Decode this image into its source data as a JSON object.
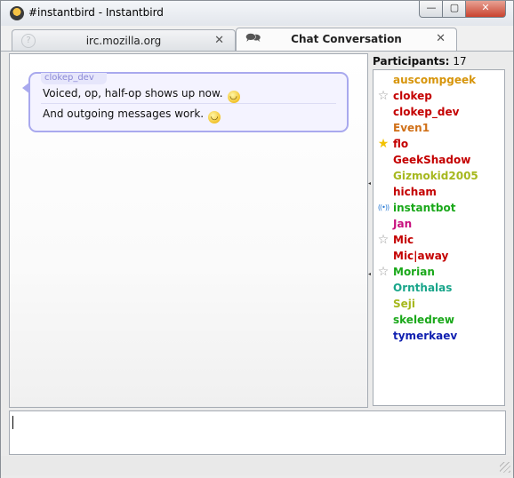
{
  "window": {
    "title": "#instantbird - Instantbird",
    "minimize_label": "—",
    "maximize_label": "▢",
    "close_label": "✕"
  },
  "tabs": [
    {
      "label": "irc.mozilla.org",
      "icon": "help-icon",
      "close_label": "✕"
    },
    {
      "label": "Chat Conversation",
      "icon": "chat-icon",
      "close_label": "✕",
      "selected": true
    }
  ],
  "conversation": {
    "sender": "clokep_dev",
    "messages": [
      {
        "text": "Voiced, op, half-op shows up now.",
        "emoticon": "smiley"
      },
      {
        "text": "And outgoing messages work.",
        "emoticon": "smiley"
      }
    ]
  },
  "participants": {
    "label": "Participants:",
    "count": "17",
    "list": [
      {
        "name": "auscompgeek",
        "color": "#d7950b",
        "status": "none"
      },
      {
        "name": "clokep",
        "color": "#c40000",
        "status": "half-op"
      },
      {
        "name": "clokep_dev",
        "color": "#c40000",
        "status": "none"
      },
      {
        "name": "Even1",
        "color": "#d07018",
        "status": "none"
      },
      {
        "name": "flo",
        "color": "#c40000",
        "status": "op"
      },
      {
        "name": "GeekShadow",
        "color": "#c40000",
        "status": "none"
      },
      {
        "name": "Gizmokid2005",
        "color": "#a6b81e",
        "status": "none"
      },
      {
        "name": "hicham",
        "color": "#c40000",
        "status": "none"
      },
      {
        "name": "instantbot",
        "color": "#1aa81a",
        "status": "voiced"
      },
      {
        "name": "Jan",
        "color": "#c8107e",
        "status": "none"
      },
      {
        "name": "Mic",
        "color": "#c40000",
        "status": "half-op"
      },
      {
        "name": "Mic|away",
        "color": "#c40000",
        "status": "none"
      },
      {
        "name": "Morian",
        "color": "#1aa81a",
        "status": "half-op"
      },
      {
        "name": "Ornthalas",
        "color": "#18a58a",
        "status": "none"
      },
      {
        "name": "Seji",
        "color": "#a6b81e",
        "status": "none"
      },
      {
        "name": "skeledrew",
        "color": "#1aa81a",
        "status": "none"
      },
      {
        "name": "tymerkaev",
        "color": "#1020b0",
        "status": "none"
      }
    ]
  },
  "input": {
    "value": ""
  }
}
